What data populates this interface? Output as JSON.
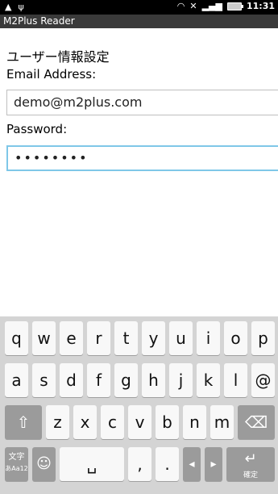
{
  "status": {
    "time": "11:31"
  },
  "app": {
    "title": "M2Plus Reader"
  },
  "form": {
    "header": "ユーザー情報設定",
    "email_label": "Email Address:",
    "email_value": "demo@m2plus.com",
    "password_label": "Password:",
    "password_mask": "••••••••"
  },
  "keyboard": {
    "row1": [
      "q",
      "w",
      "e",
      "r",
      "t",
      "y",
      "u",
      "i",
      "o",
      "p"
    ],
    "row2": [
      "a",
      "s",
      "d",
      "f",
      "g",
      "h",
      "j",
      "k",
      "l",
      "@"
    ],
    "row3": [
      "z",
      "x",
      "c",
      "v",
      "b",
      "n",
      "m"
    ],
    "mode_label_top": "文字",
    "mode_label_bottom": "あAa12",
    "comma": ",",
    "period": ".",
    "enter_label": "確定"
  }
}
